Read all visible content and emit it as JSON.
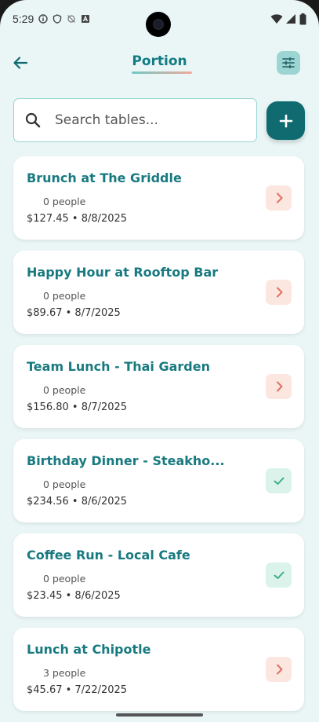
{
  "status_bar": {
    "time": "5:29",
    "icons": [
      "info-icon",
      "shield-icon",
      "sync-off-icon",
      "a-box-icon",
      "wifi-icon",
      "signal-icon",
      "battery-icon"
    ]
  },
  "header": {
    "title": "Portion",
    "back_icon": "arrow-left-icon",
    "filter_icon": "sliders-icon"
  },
  "search": {
    "placeholder": "Search tables...",
    "value": ""
  },
  "add_button": {
    "icon": "plus-icon"
  },
  "colors": {
    "primary": "#127c83",
    "add_button": "#0f6b70",
    "pending_bg": "#fce6e0",
    "pending_fg": "#e0715e",
    "done_bg": "#dcf3ec",
    "done_fg": "#3cae86",
    "background": "#eaf6f6"
  },
  "tables": [
    {
      "title": "Brunch at The Griddle",
      "people": "0 people",
      "meta": "$127.45 • 8/8/2025",
      "status": "pending"
    },
    {
      "title": "Happy Hour at Rooftop Bar",
      "people": "0 people",
      "meta": "$89.67 • 8/7/2025",
      "status": "pending"
    },
    {
      "title": "Team Lunch - Thai Garden",
      "people": "0 people",
      "meta": "$156.80 • 8/7/2025",
      "status": "pending"
    },
    {
      "title": "Birthday Dinner - Steakho...",
      "people": "0 people",
      "meta": "$234.56 • 8/6/2025",
      "status": "done"
    },
    {
      "title": "Coffee Run - Local Cafe",
      "people": "0 people",
      "meta": "$23.45 • 8/6/2025",
      "status": "done"
    },
    {
      "title": "Lunch at Chipotle",
      "people": "3 people",
      "meta": "$45.67 • 7/22/2025",
      "status": "pending"
    }
  ]
}
